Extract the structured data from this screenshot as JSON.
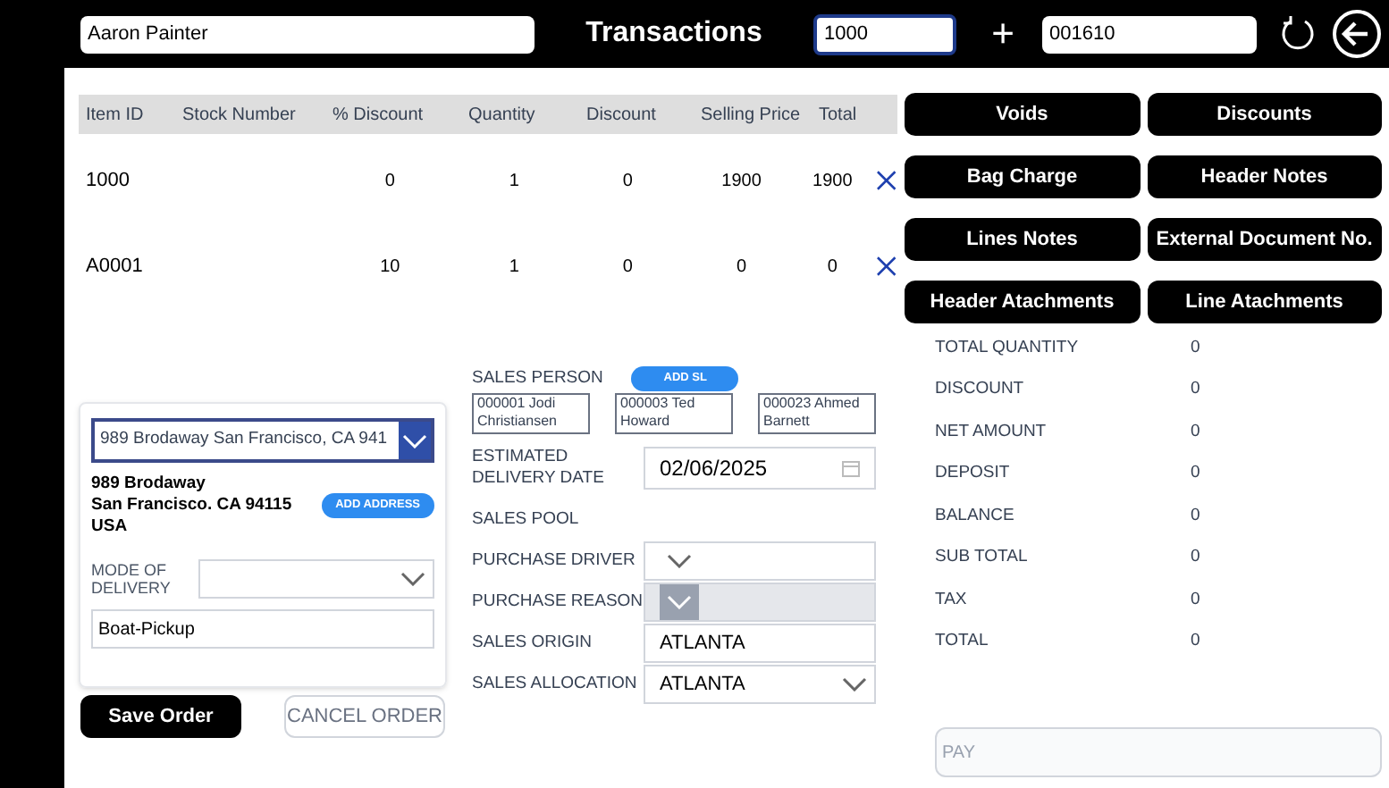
{
  "header": {
    "customer": "Aaron Painter",
    "title": "Transactions",
    "item_input": "1000",
    "plus": "+",
    "order_number": "001610"
  },
  "table": {
    "columns": [
      "Item ID",
      "Stock Number",
      "% Discount",
      "Quantity",
      "Discount",
      "Selling Price",
      "Total"
    ],
    "rows": [
      {
        "cells": [
          "1000",
          "",
          "0",
          "1",
          "0",
          "1900",
          "1900"
        ]
      },
      {
        "cells": [
          "A0001",
          "",
          "10",
          "1",
          "0",
          "0",
          "0"
        ]
      }
    ]
  },
  "actions": [
    "Voids",
    "Discounts",
    "Bag Charge",
    "Header Notes",
    "Lines Notes",
    "External Document No.",
    "Header Atachments",
    "Line Atachments"
  ],
  "address": {
    "select_value": "989 Brodaway San Francisco, CA 941",
    "lines": [
      "989 Brodaway",
      "San Francisco. CA 94115",
      "USA"
    ],
    "add_button": "ADD ADDRESS",
    "mode_label": "MODE OF DELIVERY",
    "mode_value": "Boat-Pickup"
  },
  "buttons": [
    {
      "label": "Save Order",
      "disabled": false
    },
    {
      "label": "CANCEL ORDER",
      "disabled": true
    }
  ],
  "sales": {
    "label": "SALES PERSON",
    "add_button": "ADD SL",
    "persons": [
      "000001 Jodi Christiansen",
      "000003 Ted Howard",
      "000023 Ahmed Barnett"
    ]
  },
  "fields": [
    {
      "kind": "date",
      "label": "ESTIMATED DELIVERY DATE",
      "value": "02/06/2025"
    },
    {
      "kind": "label",
      "label": "SALES POOL"
    },
    {
      "kind": "select",
      "label": "PURCHASE DRIVER",
      "disabled": false
    },
    {
      "kind": "select",
      "label": "PURCHASE REASON",
      "disabled": true
    },
    {
      "kind": "text",
      "label": "SALES ORIGIN",
      "value": "ATLANTA"
    },
    {
      "kind": "select",
      "label": "SALES ALLOCATION",
      "value": "ATLANTA",
      "disabled": false
    }
  ],
  "summary": [
    {
      "label": "TOTAL QUANTITY",
      "value": "0"
    },
    {
      "label": "DISCOUNT",
      "value": "0"
    },
    {
      "label": "NET AMOUNT",
      "value": "0"
    },
    {
      "label": "DEPOSIT",
      "value": "0"
    },
    {
      "label": "BALANCE",
      "value": "0"
    },
    {
      "label": "SUB TOTAL",
      "value": "0"
    },
    {
      "label": "TAX",
      "value": "0"
    },
    {
      "label": "TOTAL",
      "value": "0"
    }
  ],
  "pay": {
    "placeholder": "PAY"
  }
}
